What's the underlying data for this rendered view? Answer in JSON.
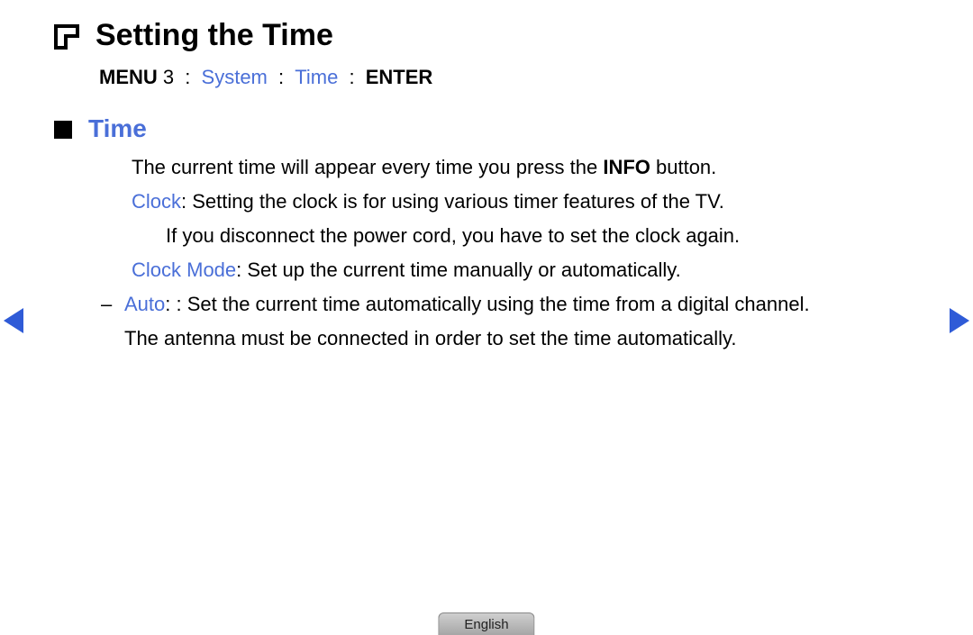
{
  "title": "Setting the Time",
  "breadcrumb": {
    "menu": "MENU",
    "num": "3",
    "system": "System",
    "time": "Time",
    "enter": "ENTER"
  },
  "section": {
    "heading": "Time",
    "line1_pre": "The current time will appear every time you press the ",
    "line1_bold": "INFO",
    "line1_post": " button.",
    "clock_label": "Clock",
    "clock_text": ": Setting the clock is for using various timer features of the TV.",
    "clock_note": "If you disconnect the power cord, you have to set the clock again.",
    "clockmode_label": "Clock Mode",
    "clockmode_text": ": Set up the current time manually or automatically.",
    "auto_label": "Auto",
    "auto_text": ": Set the current time automatically using the time from a digital channel.",
    "auto_note": "The antenna must be connected in order to set the time automatically."
  },
  "footer": {
    "language": "English"
  }
}
